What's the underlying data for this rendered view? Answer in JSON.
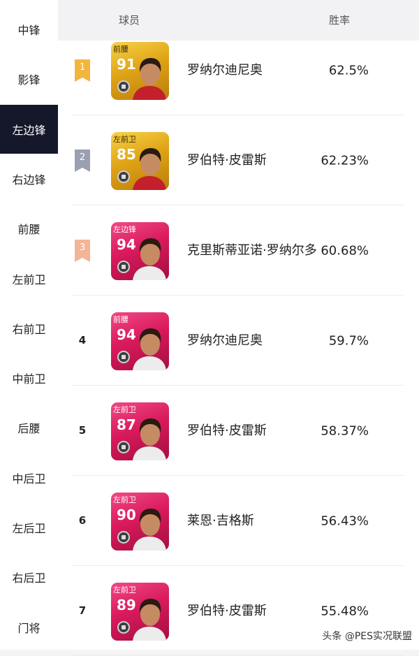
{
  "sidebar": {
    "items": [
      {
        "label": "中锋",
        "active": false
      },
      {
        "label": "影锋",
        "active": false
      },
      {
        "label": "左边锋",
        "active": true
      },
      {
        "label": "右边锋",
        "active": false
      },
      {
        "label": "前腰",
        "active": false
      },
      {
        "label": "左前卫",
        "active": false
      },
      {
        "label": "右前卫",
        "active": false
      },
      {
        "label": "中前卫",
        "active": false
      },
      {
        "label": "后腰",
        "active": false
      },
      {
        "label": "中后卫",
        "active": false
      },
      {
        "label": "左后卫",
        "active": false
      },
      {
        "label": "右后卫",
        "active": false
      },
      {
        "label": "门将",
        "active": false
      }
    ]
  },
  "header": {
    "player_col": "球员",
    "winrate_col": "胜率"
  },
  "rows": [
    {
      "rank": "1",
      "position": "前腰",
      "rating": "91",
      "name": "罗纳尔迪尼奥",
      "winrate": "62.5%",
      "card": "gold",
      "badge_color": "#f3b63d"
    },
    {
      "rank": "2",
      "position": "左前卫",
      "rating": "85",
      "name": "罗伯特·皮雷斯",
      "winrate": "62.23%",
      "card": "gold",
      "badge_color": "#9aa0b0"
    },
    {
      "rank": "3",
      "position": "左边锋",
      "rating": "94",
      "name": "克里斯蒂亚诺·罗纳尔多",
      "winrate": "60.68%",
      "card": "pink",
      "badge_color": "#f2b597"
    },
    {
      "rank": "4",
      "position": "前腰",
      "rating": "94",
      "name": "罗纳尔迪尼奥",
      "winrate": "59.7%",
      "card": "pink"
    },
    {
      "rank": "5",
      "position": "左前卫",
      "rating": "87",
      "name": "罗伯特·皮雷斯",
      "winrate": "58.37%",
      "card": "pink"
    },
    {
      "rank": "6",
      "position": "左前卫",
      "rating": "90",
      "name": "莱恩·吉格斯",
      "winrate": "56.43%",
      "card": "pink"
    },
    {
      "rank": "7",
      "position": "左前卫",
      "rating": "89",
      "name": "罗伯特·皮雷斯",
      "winrate": "55.48%",
      "card": "pink"
    }
  ],
  "watermark": "头条 @PES实况联盟",
  "colors": {
    "active_bg": "#15182b",
    "gold_card": "#e0a417",
    "pink_card": "#d91a5c"
  }
}
